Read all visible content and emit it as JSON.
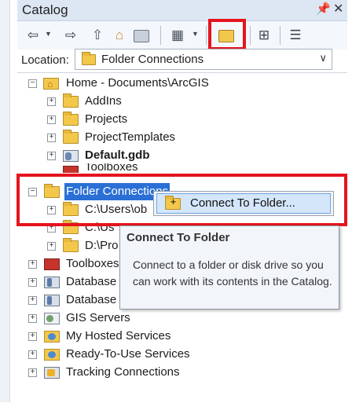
{
  "window": {
    "title": "Catalog",
    "pin_glyph": "📌",
    "close_glyph": "✕"
  },
  "toolbar": {
    "icons": [
      "back-arrow-icon",
      "forward-arrow-icon",
      "up-one-level-icon",
      "home-icon",
      "connect-to-folder-icon",
      "disconnect-folder-icon",
      "views-icon",
      "connect-to-folder-icon",
      "toggle-contents-icon",
      "options-icon"
    ],
    "highlight_color": "#e4141d"
  },
  "location": {
    "label": "Location:",
    "value": "Folder Connections"
  },
  "tree": {
    "home": "Home - Documents\\ArcGIS",
    "home_children": [
      "AddIns",
      "Projects",
      "ProjectTemplates",
      "Default.gdb",
      "Toolboxes"
    ],
    "folder_connections": "Folder Connections",
    "folder_children": [
      "C:\\Users\\ob",
      "C:\\Us",
      "D:\\Pro"
    ],
    "items": [
      "Toolboxes",
      "Database Servers",
      "Database Connections",
      "GIS Servers",
      "My Hosted Services",
      "Ready-To-Use Services",
      "Tracking Connections"
    ]
  },
  "context_menu": {
    "item_label": "Connect To Folder..."
  },
  "tooltip": {
    "title": "Connect To Folder",
    "body": "Connect to a folder or disk drive so you can work with its contents in the Catalog."
  },
  "colors": {
    "selection": "#2a6fd6",
    "menu_hover": "#d4e6fa",
    "folder": "#f3c84a"
  }
}
